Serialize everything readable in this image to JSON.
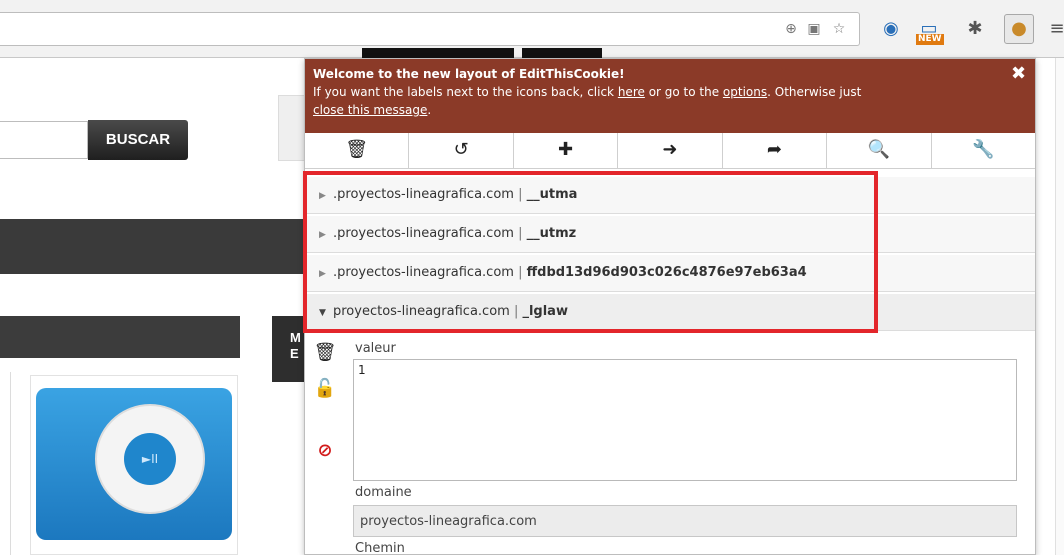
{
  "browser": {
    "toolbar_icons": [
      "zoom-icon",
      "page-action-icon",
      "bookmark-star-icon",
      "globe-extension-icon",
      "new-extension-icon",
      "bug-extension-icon",
      "cookie-extension-icon",
      "menu-icon"
    ],
    "new_badge": "NEW"
  },
  "page": {
    "search_button": "BUSCAR",
    "side_letters": "M\nE"
  },
  "popup": {
    "banner": {
      "title": "Welcome to the new layout of EditThisCookie!",
      "text_before_here": "If you want the labels next to the icons back, click ",
      "here_link": "here",
      "text_between": " or go to the ",
      "options_link": "options",
      "text_after": ". Otherwise just ",
      "close_link": "close this message",
      "text_end": ".",
      "close_glyph": "✖"
    },
    "actions": [
      {
        "name": "delete-all-icon",
        "glyph": "🗑"
      },
      {
        "name": "reset-icon",
        "glyph": "↺"
      },
      {
        "name": "add-icon",
        "glyph": "✚"
      },
      {
        "name": "import-icon",
        "glyph": "➜"
      },
      {
        "name": "export-icon",
        "glyph": "➦"
      },
      {
        "name": "search-icon",
        "glyph": "🔍"
      },
      {
        "name": "settings-wrench-icon",
        "glyph": "🔧"
      }
    ],
    "cookies": [
      {
        "domain": ".proyectos-lineagrafica.com",
        "sep": " | ",
        "name": "__utma",
        "expanded": false
      },
      {
        "domain": ".proyectos-lineagrafica.com",
        "sep": " | ",
        "name": "__utmz",
        "expanded": false
      },
      {
        "domain": ".proyectos-lineagrafica.com",
        "sep": " | ",
        "name": "ffdbd13d96d903c026c4876e97eb63a4",
        "expanded": false
      },
      {
        "domain": "proyectos-lineagrafica.com",
        "sep": " | ",
        "name": "_lglaw",
        "expanded": true
      }
    ],
    "details": {
      "value_label": "valeur",
      "value": "1",
      "domain_label": "domaine",
      "domain_value": "proyectos-lineagrafica.com",
      "path_label": "Chemin"
    }
  },
  "colors": {
    "banner_bg": "#8b3a28",
    "highlight": "#e3262b"
  }
}
